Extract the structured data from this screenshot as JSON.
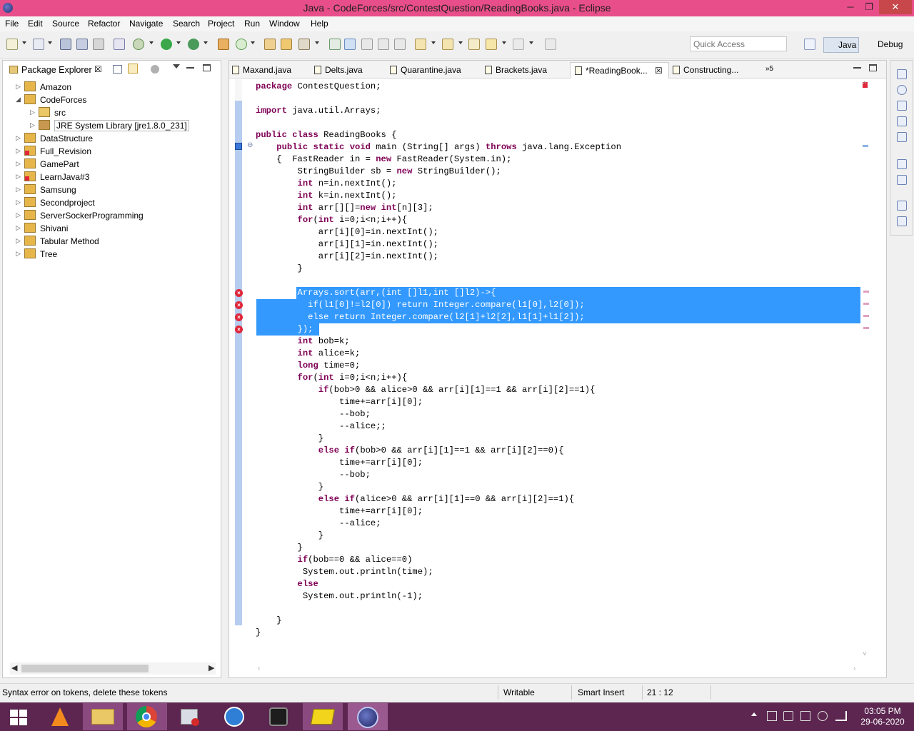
{
  "window": {
    "title": "Java - CodeForces/src/ContestQuestion/ReadingBooks.java - Eclipse",
    "min_glyph": "─",
    "max_glyph": "❐",
    "close_glyph": "✕"
  },
  "menu": [
    "File",
    "Edit",
    "Source",
    "Refactor",
    "Navigate",
    "Search",
    "Project",
    "Run",
    "Window",
    "Help"
  ],
  "quick_access": {
    "placeholder": "Quick Access"
  },
  "perspectives": {
    "java": "Java",
    "debug": "Debug"
  },
  "package_explorer": {
    "title": "Package Explorer",
    "close": "☒",
    "items": [
      {
        "label": "Amazon",
        "expanded": false,
        "level": 0,
        "icon": "project-icon"
      },
      {
        "label": "CodeForces",
        "expanded": true,
        "level": 0,
        "icon": "project-icon"
      },
      {
        "label": "src",
        "expanded": false,
        "level": 1,
        "icon": "src-folder-icon"
      },
      {
        "label": "JRE System Library [jre1.8.0_231]",
        "expanded": false,
        "level": 1,
        "icon": "library-icon"
      },
      {
        "label": "DataStructure",
        "expanded": false,
        "level": 0,
        "icon": "project-icon"
      },
      {
        "label": "Full_Revision",
        "expanded": false,
        "level": 0,
        "icon": "project-error-icon"
      },
      {
        "label": "GamePart",
        "expanded": false,
        "level": 0,
        "icon": "project-icon"
      },
      {
        "label": "LearnJava#3",
        "expanded": false,
        "level": 0,
        "icon": "project-error-icon"
      },
      {
        "label": "Samsung",
        "expanded": false,
        "level": 0,
        "icon": "project-icon"
      },
      {
        "label": "Secondproject",
        "expanded": false,
        "level": 0,
        "icon": "project-icon"
      },
      {
        "label": "ServerSockerProgramming",
        "expanded": false,
        "level": 0,
        "icon": "project-icon"
      },
      {
        "label": "Shivani",
        "expanded": false,
        "level": 0,
        "icon": "project-icon"
      },
      {
        "label": "Tabular Method",
        "expanded": false,
        "level": 0,
        "icon": "project-icon"
      },
      {
        "label": "Tree",
        "expanded": false,
        "level": 0,
        "icon": "project-icon"
      }
    ]
  },
  "editor": {
    "tabs": [
      {
        "label": "Maxand.java",
        "active": false
      },
      {
        "label": "Delts.java",
        "active": false
      },
      {
        "label": "Quarantine.java",
        "active": false
      },
      {
        "label": "Brackets.java",
        "active": false
      },
      {
        "label": "*ReadingBook...",
        "active": true
      },
      {
        "label": "Constructing...",
        "active": false
      }
    ],
    "overflow_label": "»5",
    "tab_close": "☒",
    "code": [
      "package ContestQuestion;",
      "",
      "import java.util.Arrays;",
      "",
      "public class ReadingBooks {",
      "    public static void main (String[] args) throws java.lang.Exception",
      "    {  FastReader in = new FastReader(System.in);",
      "        StringBuilder sb = new StringBuilder();",
      "        int n=in.nextInt();",
      "        int k=in.nextInt();",
      "        int arr[][]=new int[n][3];",
      "        for(int i=0;i<n;i++){",
      "            arr[i][0]=in.nextInt();",
      "            arr[i][1]=in.nextInt();",
      "            arr[i][2]=in.nextInt();",
      "        }",
      "",
      "        Arrays.sort(arr,(int []l1,int []l2)->{",
      "          if(l1[0]!=l2[0]) return Integer.compare(l1[0],l2[0]);",
      "          else return Integer.compare(l2[1]+l2[2],l1[1]+l1[2]);",
      "        });",
      "        int bob=k;",
      "        int alice=k;",
      "        long time=0;",
      "        for(int i=0;i<n;i++){",
      "            if(bob>0 && alice>0 && arr[i][1]==1 && arr[i][2]==1){",
      "                time+=arr[i][0];",
      "                --bob;",
      "                --alice;;",
      "            }",
      "            else if(bob>0 && arr[i][1]==1 && arr[i][2]==0){",
      "                time+=arr[i][0];",
      "                --bob;",
      "            }",
      "            else if(alice>0 && arr[i][1]==0 && arr[i][2]==1){",
      "                time+=arr[i][0];",
      "                --alice;",
      "            }",
      "        }",
      "        if(bob==0 && alice==0)",
      "         System.out.println(time);",
      "        else",
      "         System.out.println(-1);",
      "",
      "    }",
      "}"
    ],
    "selected_lines": [
      17,
      18,
      19,
      20
    ],
    "error_lines": [
      17,
      18,
      19,
      20
    ]
  },
  "status": {
    "message": "Syntax error on tokens, delete these tokens",
    "writable": "Writable",
    "insert_mode": "Smart Insert",
    "position": "21 : 12"
  },
  "taskbar": {
    "time": "03:05 PM",
    "date": "29-06-2020"
  },
  "colors": {
    "titlebar": "#e84f8a",
    "selection": "#3399ff",
    "keyword": "#7f0055",
    "taskbar": "#5c2650"
  }
}
